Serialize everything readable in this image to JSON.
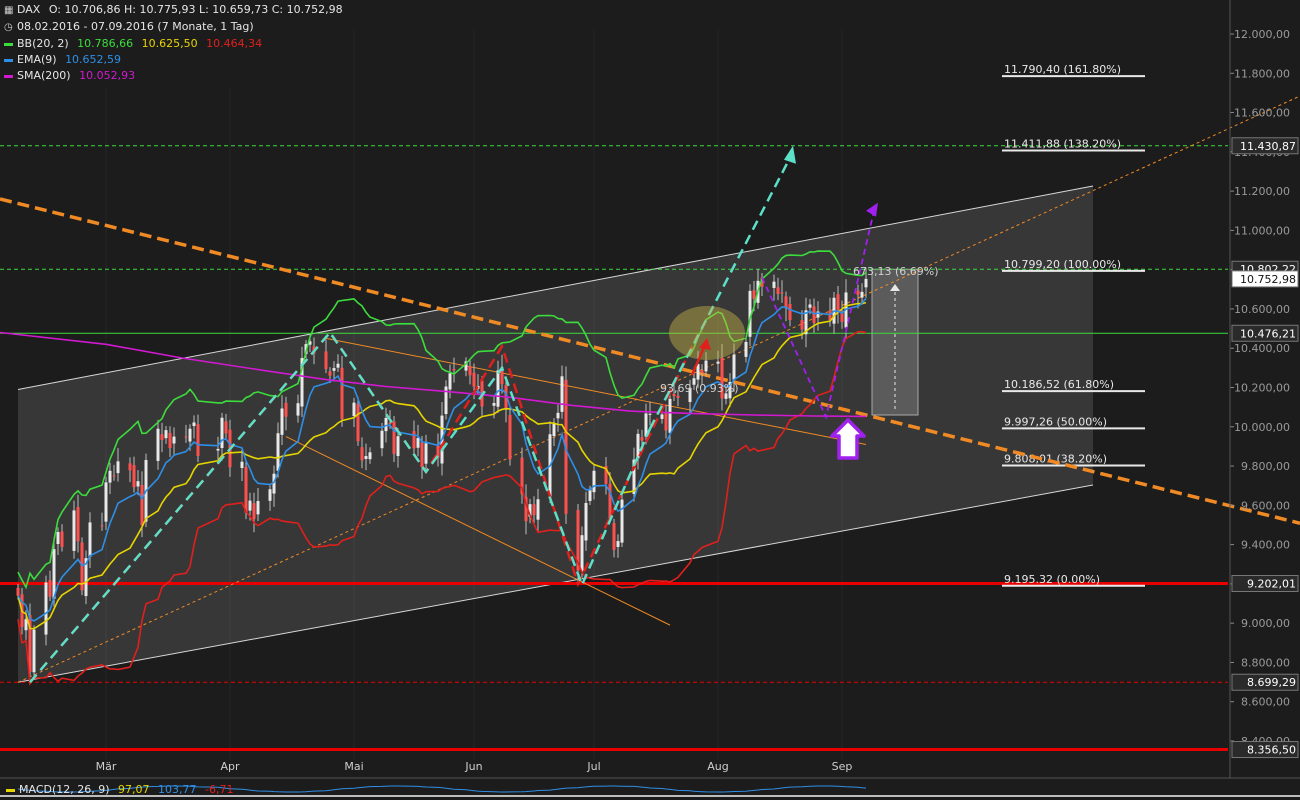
{
  "header": {
    "symbol": "DAX",
    "ohlc": "O: 10.706,86  H: 10.775,93  L: 10.659,73  C: 10.752,98",
    "period": "08.02.2016 - 07.09.2016 (7 Monate, 1 Tag)",
    "indicators": [
      {
        "label": "BB(20, 2)",
        "color": "#3ddc3d",
        "values": [
          {
            "text": "10.786,66",
            "color": "#3ddc3d"
          },
          {
            "text": "10.625,50",
            "color": "#e6d400"
          },
          {
            "text": "10.464,34",
            "color": "#e0201c"
          }
        ]
      },
      {
        "label": "EMA(9)",
        "color": "#2f8fe6",
        "values": [
          {
            "text": "10.652,59",
            "color": "#2f8fe6"
          }
        ]
      },
      {
        "label": "SMA(200)",
        "color": "#d219d2",
        "values": [
          {
            "text": "10.052,93",
            "color": "#d219d2"
          }
        ]
      }
    ],
    "macd": {
      "label": "MACD(12, 26, 9)",
      "v1": "97,07",
      "v2": "103,77",
      "v3": "-6,71",
      "c1": "#e6d400",
      "c2": "#2f8fe6",
      "c3": "#e0201c"
    }
  },
  "chart_data": {
    "type": "candlestick",
    "y_axis": {
      "min": 8300,
      "max": 12050,
      "side": "right",
      "ticks": [
        8400,
        8600,
        8800,
        9000,
        9200,
        9400,
        9600,
        9800,
        10000,
        10200,
        10400,
        10600,
        10800,
        11000,
        11200,
        11400,
        11600,
        11800,
        12000
      ],
      "tick_labels": [
        "8.400,00",
        "8.600,00",
        "8.800,00",
        "9.000,00",
        "9.200,00",
        "9.400,00",
        "9.600,00",
        "9.800,00",
        "10.000,00",
        "10.200,00",
        "10.400,00",
        "10.600,00",
        "10.800,00",
        "11.000,00",
        "11.200,00",
        "11.400,00",
        "11.600,00",
        "11.800,00",
        "12.000,00"
      ]
    },
    "x_axis": {
      "start": "2016-02-08",
      "end": "2016-09-07",
      "month_labels": [
        {
          "label": "Mär",
          "date": "2016-03-01"
        },
        {
          "label": "Apr",
          "date": "2016-04-01"
        },
        {
          "label": "Mai",
          "date": "2016-05-02"
        },
        {
          "label": "Jun",
          "date": "2016-06-01"
        },
        {
          "label": "Jul",
          "date": "2016-07-01"
        },
        {
          "label": "Aug",
          "date": "2016-08-01"
        },
        {
          "label": "Sep",
          "date": "2016-09-01"
        }
      ]
    },
    "close_series": [
      [
        "2016-02-08",
        9140
      ],
      [
        "2016-02-09",
        8980
      ],
      [
        "2016-02-10",
        9020
      ],
      [
        "2016-02-11",
        8752
      ],
      [
        "2016-02-12",
        8967
      ],
      [
        "2016-02-15",
        9207
      ],
      [
        "2016-02-16",
        9135
      ],
      [
        "2016-02-17",
        9377
      ],
      [
        "2016-02-18",
        9464
      ],
      [
        "2016-02-19",
        9388
      ],
      [
        "2016-02-22",
        9574
      ],
      [
        "2016-02-23",
        9417
      ],
      [
        "2016-02-24",
        9167
      ],
      [
        "2016-02-25",
        9331
      ],
      [
        "2016-02-26",
        9513
      ],
      [
        "2016-02-29",
        9495
      ],
      [
        "2016-03-01",
        9717
      ],
      [
        "2016-03-02",
        9776
      ],
      [
        "2016-03-03",
        9751
      ],
      [
        "2016-03-04",
        9824
      ],
      [
        "2016-03-07",
        9778
      ],
      [
        "2016-03-08",
        9692
      ],
      [
        "2016-03-09",
        9723
      ],
      [
        "2016-03-10",
        9499
      ],
      [
        "2016-03-11",
        9831
      ],
      [
        "2016-03-14",
        9990
      ],
      [
        "2016-03-15",
        9933
      ],
      [
        "2016-03-16",
        9983
      ],
      [
        "2016-03-17",
        9892
      ],
      [
        "2016-03-18",
        9950
      ],
      [
        "2016-03-21",
        9948
      ],
      [
        "2016-03-22",
        9990
      ],
      [
        "2016-03-23",
        10022
      ],
      [
        "2016-03-24",
        9851
      ],
      [
        "2016-03-29",
        9887
      ],
      [
        "2016-03-30",
        10046
      ],
      [
        "2016-03-31",
        9966
      ],
      [
        "2016-04-01",
        9794
      ],
      [
        "2016-04-04",
        9822
      ],
      [
        "2016-04-05",
        9563
      ],
      [
        "2016-04-06",
        9624
      ],
      [
        "2016-04-07",
        9530
      ],
      [
        "2016-04-08",
        9622
      ],
      [
        "2016-04-11",
        9682
      ],
      [
        "2016-04-12",
        9761
      ],
      [
        "2016-04-13",
        9967
      ],
      [
        "2016-04-14",
        10093
      ],
      [
        "2016-04-15",
        10051
      ],
      [
        "2016-04-18",
        10120
      ],
      [
        "2016-04-19",
        10350
      ],
      [
        "2016-04-20",
        10421
      ],
      [
        "2016-04-21",
        10435
      ],
      [
        "2016-04-22",
        10373
      ],
      [
        "2016-04-25",
        10294
      ],
      [
        "2016-04-26",
        10260
      ],
      [
        "2016-04-27",
        10299
      ],
      [
        "2016-04-28",
        10321
      ],
      [
        "2016-04-29",
        10039
      ],
      [
        "2016-05-02",
        10123
      ],
      [
        "2016-05-03",
        9926
      ],
      [
        "2016-05-04",
        9829
      ],
      [
        "2016-05-05",
        9851
      ],
      [
        "2016-05-06",
        9870
      ],
      [
        "2016-05-09",
        9980
      ],
      [
        "2016-05-10",
        10045
      ],
      [
        "2016-05-11",
        10015
      ],
      [
        "2016-05-12",
        9862
      ],
      [
        "2016-05-13",
        9952
      ],
      [
        "2016-05-17",
        9890
      ],
      [
        "2016-05-18",
        9943
      ],
      [
        "2016-05-19",
        9795
      ],
      [
        "2016-05-20",
        9916
      ],
      [
        "2016-05-23",
        9842
      ],
      [
        "2016-05-24",
        10057
      ],
      [
        "2016-05-25",
        10205
      ],
      [
        "2016-05-26",
        10272
      ],
      [
        "2016-05-27",
        10287
      ],
      [
        "2016-05-30",
        10333
      ],
      [
        "2016-05-31",
        10262
      ],
      [
        "2016-06-01",
        10204
      ],
      [
        "2016-06-02",
        10208
      ],
      [
        "2016-06-03",
        10103
      ],
      [
        "2016-06-06",
        10121
      ],
      [
        "2016-06-07",
        10287
      ],
      [
        "2016-06-08",
        10217
      ],
      [
        "2016-06-09",
        10088
      ],
      [
        "2016-06-10",
        9834
      ],
      [
        "2016-06-13",
        9657
      ],
      [
        "2016-06-14",
        9519
      ],
      [
        "2016-06-15",
        9606
      ],
      [
        "2016-06-16",
        9550
      ],
      [
        "2016-06-17",
        9631
      ],
      [
        "2016-06-20",
        9962
      ],
      [
        "2016-06-21",
        10015
      ],
      [
        "2016-06-22",
        10071
      ],
      [
        "2016-06-23",
        10257
      ],
      [
        "2016-06-24",
        9557
      ],
      [
        "2016-06-27",
        9268
      ],
      [
        "2016-06-28",
        9448
      ],
      [
        "2016-06-29",
        9612
      ],
      [
        "2016-06-30",
        9680
      ],
      [
        "2016-07-01",
        9776
      ],
      [
        "2016-07-04",
        9709
      ],
      [
        "2016-07-05",
        9532
      ],
      [
        "2016-07-06",
        9373
      ],
      [
        "2016-07-07",
        9418
      ],
      [
        "2016-07-08",
        9629
      ],
      [
        "2016-07-11",
        9833
      ],
      [
        "2016-07-12",
        9964
      ],
      [
        "2016-07-13",
        9930
      ],
      [
        "2016-07-14",
        10068
      ],
      [
        "2016-07-15",
        10066
      ],
      [
        "2016-07-18",
        10063
      ],
      [
        "2016-07-19",
        9981
      ],
      [
        "2016-07-20",
        10142
      ],
      [
        "2016-07-21",
        10156
      ],
      [
        "2016-07-22",
        10147
      ],
      [
        "2016-07-25",
        10198
      ],
      [
        "2016-07-26",
        10247
      ],
      [
        "2016-07-27",
        10319
      ],
      [
        "2016-07-28",
        10275
      ],
      [
        "2016-07-29",
        10337
      ],
      [
        "2016-08-01",
        10331
      ],
      [
        "2016-08-02",
        10144
      ],
      [
        "2016-08-03",
        10170
      ],
      [
        "2016-08-04",
        10228
      ],
      [
        "2016-08-05",
        10367
      ],
      [
        "2016-08-08",
        10432
      ],
      [
        "2016-08-09",
        10692
      ],
      [
        "2016-08-10",
        10651
      ],
      [
        "2016-08-11",
        10743
      ],
      [
        "2016-08-12",
        10713
      ],
      [
        "2016-08-15",
        10739
      ],
      [
        "2016-08-16",
        10676
      ],
      [
        "2016-08-17",
        10679
      ],
      [
        "2016-08-18",
        10603
      ],
      [
        "2016-08-19",
        10544
      ],
      [
        "2016-08-22",
        10495
      ],
      [
        "2016-08-23",
        10593
      ],
      [
        "2016-08-24",
        10623
      ],
      [
        "2016-08-25",
        10529
      ],
      [
        "2016-08-26",
        10587
      ],
      [
        "2016-08-29",
        10544
      ],
      [
        "2016-08-30",
        10657
      ],
      [
        "2016-08-31",
        10593
      ],
      [
        "2016-09-01",
        10534
      ],
      [
        "2016-09-02",
        10684
      ],
      [
        "2016-09-05",
        10672
      ],
      [
        "2016-09-06",
        10687
      ],
      [
        "2016-09-07",
        10753
      ]
    ],
    "bollinger": {
      "period": 20,
      "stddev": 2,
      "upper_color": "#3ddc3d",
      "middle_color": "#e6d400",
      "lower_color": "#e0201c"
    },
    "ema": {
      "period": 9,
      "color": "#2f8fe6"
    },
    "sma200": {
      "color": "#d219d2",
      "points": [
        [
          "2016-02-08",
          10480
        ],
        [
          "2016-03-01",
          10420
        ],
        [
          "2016-03-20",
          10350
        ],
        [
          "2016-04-10",
          10285
        ],
        [
          "2016-04-25",
          10240
        ],
        [
          "2016-05-10",
          10205
        ],
        [
          "2016-05-25",
          10180
        ],
        [
          "2016-06-10",
          10150
        ],
        [
          "2016-06-25",
          10110
        ],
        [
          "2016-07-10",
          10080
        ],
        [
          "2016-07-25",
          10068
        ],
        [
          "2016-08-10",
          10060
        ],
        [
          "2016-08-25",
          10055
        ],
        [
          "2016-09-07",
          10053
        ]
      ]
    },
    "fibonacci": [
      {
        "value": 11790.4,
        "label": "11.790,40 (161.80%)"
      },
      {
        "value": 11411.88,
        "label": "11.411,88 (138.20%)"
      },
      {
        "value": 10799.2,
        "label": "10.799,20 (100.00%)"
      },
      {
        "value": 10186.52,
        "label": "10.186,52 (61.80%)"
      },
      {
        "value": 9997.26,
        "label": "9.997,26 (50.00%)"
      },
      {
        "value": 9808.01,
        "label": "9.808,01 (38.20%)"
      },
      {
        "value": 9195.32,
        "label": "9.195.32 (0.00%)"
      }
    ],
    "price_labels": [
      {
        "value": 11430.87,
        "text": "11.430,87",
        "bg": "#2a2a2a",
        "fg": "#ffffff"
      },
      {
        "value": 10802.22,
        "text": "10.802,22",
        "bg": "#2a2a2a",
        "fg": "#ffffff"
      },
      {
        "value": 10752.98,
        "text": "10.752,98",
        "bg": "#ffffff",
        "fg": "#111111"
      },
      {
        "value": 10476.21,
        "text": "10.476,21",
        "bg": "#2a2a2a",
        "fg": "#ffffff"
      },
      {
        "value": 9202.01,
        "text": "9.202,01",
        "bg": "#2a2a2a",
        "fg": "#ffffff"
      },
      {
        "value": 8699.29,
        "text": "8.699,29",
        "bg": "#2a2a2a",
        "fg": "#ffffff"
      },
      {
        "value": 8356.5,
        "text": "8.356,50",
        "bg": "#2a2a2a",
        "fg": "#ffffff"
      }
    ],
    "horizontal_lines": [
      {
        "value": 11430.87,
        "color": "#3ddc3d",
        "style": "dashed"
      },
      {
        "value": 10802.22,
        "color": "#3ddc3d",
        "style": "dashed"
      },
      {
        "value": 10476.21,
        "color": "#3ddc3d",
        "style": "solid"
      },
      {
        "value": 9202.01,
        "color": "#e80000",
        "style": "solid-thick"
      },
      {
        "value": 8699.29,
        "color": "#e80000",
        "style": "dashed"
      },
      {
        "value": 8356.5,
        "color": "#e80000",
        "style": "solid-thick"
      }
    ],
    "channel": {
      "lower": [
        [
          "2016-02-08",
          8699
        ],
        [
          "2016-09-07",
          9705
        ]
      ],
      "upper": [
        [
          "2016-02-08",
          10190
        ],
        [
          "2016-09-07",
          11220
        ]
      ],
      "fill": "rgba(255,255,255,0.12)"
    },
    "downtrend_line": {
      "color": "#f08a24",
      "points": [
        [
          "2016-02-08",
          11160
        ],
        [
          "2016-09-07",
          10060
        ]
      ]
    },
    "thin_trend_lines": [
      {
        "color": "#f08a24",
        "points": [
          [
            "2016-04-25",
            10450
          ],
          [
            "2016-09-07",
            9910
          ]
        ]
      },
      {
        "color": "#f08a24",
        "points": [
          [
            "2016-04-15",
            9950
          ],
          [
            "2016-07-20",
            8990
          ]
        ]
      },
      {
        "color": "#f08a24",
        "style": "dotted",
        "points": [
          [
            "2016-02-08",
            8699
          ],
          [
            "2016-09-07",
            11680
          ]
        ]
      }
    ],
    "annotations": [
      {
        "text": "673,13 (6.69%)"
      },
      {
        "text": "93,69 (0.93%)"
      }
    ],
    "swing_lines": {
      "red": [
        [
          "2016-02-11",
          8699
        ],
        [
          "2016-04-26",
          10480
        ],
        [
          "2016-05-20",
          9770
        ],
        [
          "2016-06-08",
          10410
        ],
        [
          "2016-06-27",
          9200
        ],
        [
          "2016-07-27",
          10470
        ]
      ],
      "cyan": [
        [
          "2016-02-11",
          8699
        ],
        [
          "2016-04-26",
          10480
        ],
        [
          "2016-05-20",
          9770
        ],
        [
          "2016-06-08",
          10300
        ],
        [
          "2016-06-28",
          9195
        ],
        [
          "2016-07-15",
          9990
        ]
      ],
      "cyan_target": [
        [
          "2016-07-15",
          9990
        ],
        [
          "2016-08-19",
          11370
        ]
      ],
      "purple": [
        [
          "2016-08-12",
          10760
        ],
        [
          "2016-08-28",
          10050
        ],
        [
          "2016-09-09",
          11100
        ]
      ]
    },
    "macd": {
      "values": [
        97.07,
        103.77,
        -6.71
      ]
    }
  }
}
